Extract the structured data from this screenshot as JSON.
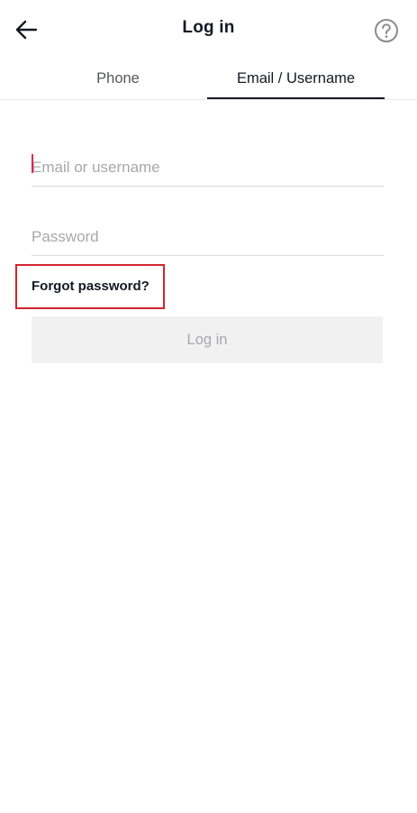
{
  "header": {
    "title": "Log in",
    "back_icon": "arrow-left-icon",
    "help_icon": "question-circle-icon"
  },
  "tabs": [
    {
      "label": "Phone",
      "selected": false
    },
    {
      "label": "Email / Username",
      "selected": true
    }
  ],
  "form": {
    "email_placeholder": "Email or username",
    "email_value": "",
    "password_placeholder": "Password",
    "password_value": "",
    "forgot_label": "Forgot password?",
    "login_label": "Log in"
  },
  "colors": {
    "text": "#161823",
    "caret": "#e0284d",
    "highlight": "#d0252d",
    "button_disabled_bg": "#f1f1f2",
    "button_disabled_text": "#a7a8ac"
  }
}
